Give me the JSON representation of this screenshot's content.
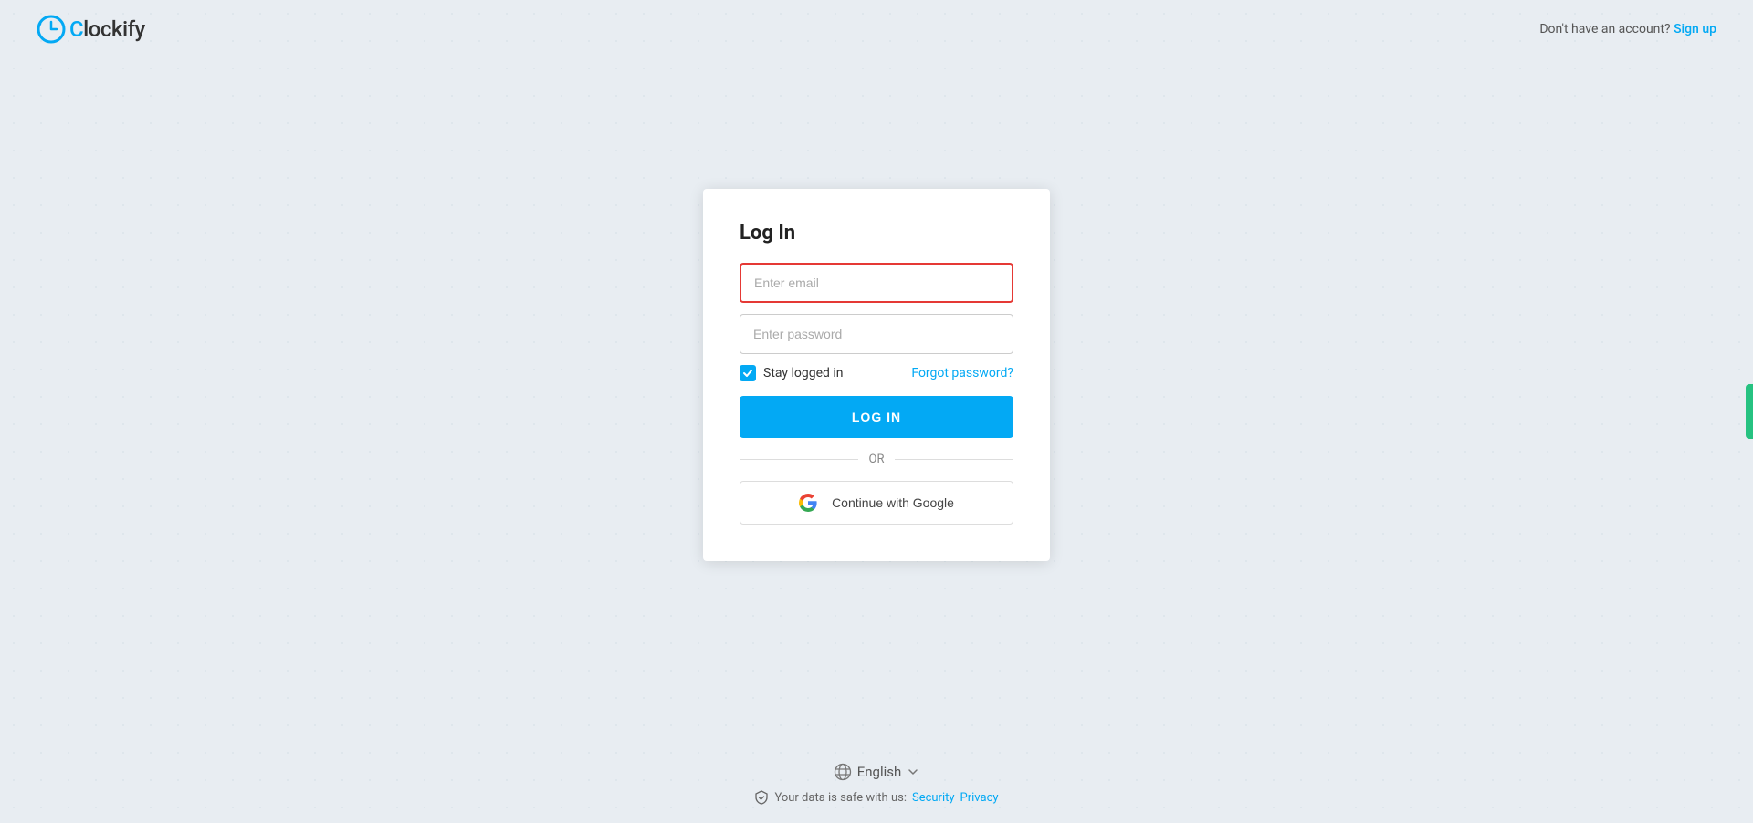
{
  "header": {
    "logo_text": "lockify",
    "no_account_text": "Don't have an account?",
    "signup_label": "Sign up"
  },
  "login_card": {
    "title": "Log In",
    "email_placeholder": "Enter email",
    "password_placeholder": "Enter password",
    "stay_logged_label": "Stay logged in",
    "forgot_label": "Forgot password?",
    "login_button": "LOG IN",
    "or_text": "OR",
    "google_button": "Continue with Google"
  },
  "footer": {
    "language": "English",
    "security_text": "Your data is safe with us:",
    "security_link": "Security",
    "privacy_link": "Privacy"
  }
}
